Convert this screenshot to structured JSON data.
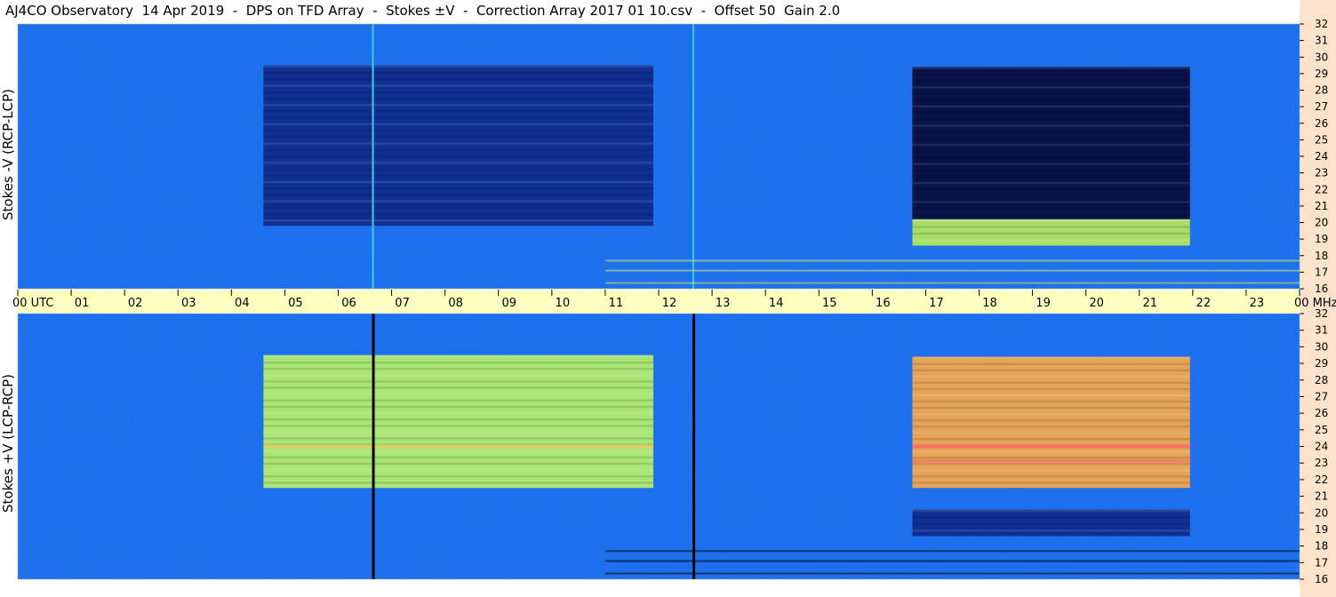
{
  "title": "AJ4CO Observatory  14 Apr 2019  -  DPS on TFD Array  -  Stokes ±V  -  Correction Array 2017 01 10.csv  -  Offset 50  Gain 2.0",
  "colors": {
    "background": "#1a6ff0",
    "time_axis_band": "#ffffc0",
    "right_margin": "#fde3cc",
    "dark_band": "#0a1a6a",
    "bright_band": "#e8f04a",
    "hot_band": "#ff6a6a"
  },
  "chart_data": [
    {
      "type": "heatmap",
      "panel": "top",
      "ylabel": "Stokes -V (RCP-LCP)",
      "y_unit": "MHz",
      "yrange": [
        16,
        32
      ],
      "y_ticks": [
        "16",
        "17",
        "18",
        "19",
        "20",
        "21",
        "22",
        "23",
        "24",
        "25",
        "26",
        "27",
        "28",
        "29",
        "30",
        "31",
        "32"
      ],
      "x_unit": "UTC (hours)",
      "xrange": [
        0,
        24
      ],
      "features": [
        {
          "name": "Sun activity block",
          "x_start": 4.6,
          "x_end": 11.9,
          "y_low": 19.8,
          "y_high": 29.5,
          "level": "dark"
        },
        {
          "name": "Jupiter block",
          "x_start": 16.75,
          "x_end": 21.95,
          "y_low": 18.6,
          "y_high": 29.4,
          "level": "very-dark"
        },
        {
          "name": "low band bright rows",
          "x_start": 16.75,
          "x_end": 21.95,
          "y_low": 18.6,
          "y_high": 20.2,
          "level": "bright"
        },
        {
          "name": "vertical line A",
          "x": 6.65
        },
        {
          "name": "vertical line B",
          "x": 12.65
        }
      ]
    },
    {
      "type": "heatmap",
      "panel": "bottom",
      "ylabel": "Stokes +V (LCP-RCP)",
      "y_unit": "MHz",
      "yrange": [
        16,
        32
      ],
      "y_ticks": [
        "16",
        "17",
        "18",
        "19",
        "20",
        "21",
        "22",
        "23",
        "24",
        "25",
        "26",
        "27",
        "28",
        "29",
        "30",
        "31",
        "32"
      ],
      "x_unit": "UTC (hours)",
      "xrange": [
        0,
        24
      ],
      "features": [
        {
          "name": "Sun activity block",
          "x_start": 4.6,
          "x_end": 11.9,
          "y_low": 21.5,
          "y_high": 29.5,
          "level": "bright"
        },
        {
          "name": "Jupiter block",
          "x_start": 16.75,
          "x_end": 21.95,
          "y_low": 21.5,
          "y_high": 29.4,
          "level": "hot"
        },
        {
          "name": "low band dark rows",
          "x_start": 16.75,
          "x_end": 21.95,
          "y_low": 18.6,
          "y_high": 20.2,
          "level": "dark"
        },
        {
          "name": "vertical line A",
          "x": 6.65
        },
        {
          "name": "vertical line B",
          "x": 12.65
        }
      ]
    }
  ],
  "time_axis": {
    "labels": [
      "00 UTC",
      "01",
      "02",
      "03",
      "04",
      "05",
      "06",
      "07",
      "08",
      "09",
      "10",
      "11",
      "12",
      "13",
      "14",
      "15",
      "16",
      "17",
      "18",
      "19",
      "20",
      "21",
      "22",
      "23",
      "00 MHz"
    ]
  }
}
